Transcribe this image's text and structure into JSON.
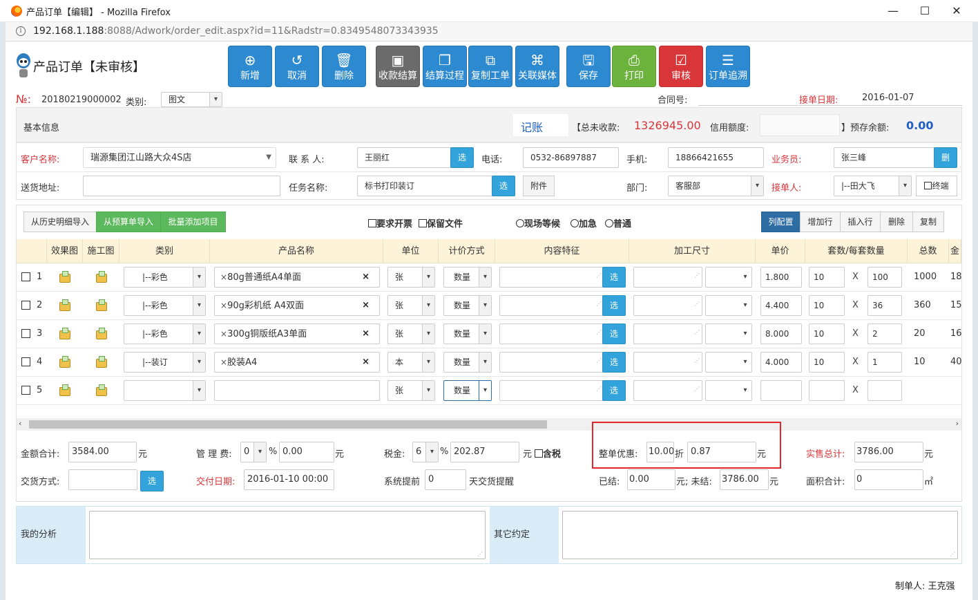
{
  "window": {
    "title": "产品订单【编辑】 - Mozilla Firefox",
    "min": "—",
    "max": "☐",
    "close": "✕"
  },
  "url": {
    "host": "192.168.1.188",
    "rest": ":8088/Adwork/order_edit.aspx?id=11&Radstr=0.8349548073343935"
  },
  "header": {
    "title": "产品订单【未审核】"
  },
  "toolbar": [
    {
      "label": "新增",
      "icon": "plus-circle-icon",
      "glyph": "⊕"
    },
    {
      "label": "取消",
      "icon": "undo-icon",
      "glyph": "↺"
    },
    {
      "label": "删除",
      "icon": "trash-icon",
      "glyph": "🗑"
    },
    {
      "label": "收款结算",
      "icon": "money-icon",
      "glyph": "▣"
    },
    {
      "label": "结算过程",
      "icon": "document-icon",
      "glyph": "❐"
    },
    {
      "label": "复制工单",
      "icon": "copy-icon",
      "glyph": "⧉"
    },
    {
      "label": "关联媒体",
      "icon": "paperclip-icon",
      "glyph": "⌘"
    },
    {
      "label": "保存",
      "icon": "save-icon",
      "glyph": "🖫"
    },
    {
      "label": "打印",
      "icon": "print-icon",
      "glyph": "⎙"
    },
    {
      "label": "审核",
      "icon": "check-icon",
      "glyph": "☑"
    },
    {
      "label": "订单追溯",
      "icon": "list-icon",
      "glyph": "☰"
    }
  ],
  "order": {
    "no_label": "№:",
    "no": "20180219000002",
    "type_label": "类别:",
    "type": "图文",
    "contract_label": "合同号:",
    "date_label": "接单日期:",
    "date": "2016-01-07"
  },
  "basic": {
    "title": "基本信息",
    "bookkeeping": "记账",
    "unpaid_label": "【总未收款:",
    "unpaid": "1326945.00",
    "credit_label": "信用额度:",
    "prepaid_label": "】预存余额:",
    "prepaid": "0.00",
    "customer_label": "客户名称:",
    "customer": "瑞源集团江山路大众4S店",
    "contact_label": "联 系 人:",
    "contact": "王丽红",
    "select_btn": "选",
    "phone_label": "电话:",
    "phone": "0532-86897887",
    "mobile_label": "手机:",
    "mobile": "18866421655",
    "salesman_label": "业务员:",
    "salesman": "张三峰",
    "delete_btn": "删",
    "address_label": "送货地址:",
    "address": "",
    "task_label": "任务名称:",
    "task": "标书打印装订",
    "attach_btn": "附件",
    "dept_label": "部门:",
    "dept": "客服部",
    "receiver_label": "接单人:",
    "receiver": "|--田大飞",
    "final_label": "终端"
  },
  "items_toolbar": {
    "import_history": "从历史明细导入",
    "import_budget": "从预算单导入",
    "batch_add": "批量添加项目",
    "invoice": "要求开票",
    "keep_file": "保留文件",
    "opt_wait": "现场等候",
    "opt_urgent": "加急",
    "opt_normal": "普通",
    "col_config": "列配置",
    "add_row": "增加行",
    "insert_row": "插入行",
    "delete": "删除",
    "copy": "复制"
  },
  "columns": [
    "效果图",
    "施工图",
    "类别",
    "产品名称",
    "单位",
    "计价方式",
    "内容特征",
    "加工尺寸",
    "单价",
    "套数/每套数量",
    "总数",
    "金"
  ],
  "rows": [
    {
      "no": "1",
      "category": "|--彩色",
      "product": "80g普通纸A4单面",
      "unit": "张",
      "pricing": "数量",
      "price": "1.800",
      "sets": "10",
      "per": "100",
      "total": "1000",
      "amt": "18"
    },
    {
      "no": "2",
      "category": "|--彩色",
      "product": "90g彩机纸 A4双面",
      "unit": "张",
      "pricing": "数量",
      "price": "4.400",
      "sets": "10",
      "per": "36",
      "total": "360",
      "amt": "15"
    },
    {
      "no": "3",
      "category": "|--彩色",
      "product": "300g铜版纸A3单面",
      "unit": "张",
      "pricing": "数量",
      "price": "8.000",
      "sets": "10",
      "per": "2",
      "total": "20",
      "amt": "16"
    },
    {
      "no": "4",
      "category": "|--装订",
      "product": "胶装A4",
      "unit": "本",
      "pricing": "数量",
      "price": "4.000",
      "sets": "10",
      "per": "1",
      "total": "10",
      "amt": "40"
    },
    {
      "no": "5",
      "category": "",
      "product": "",
      "unit": "张",
      "pricing": "数量",
      "price": "",
      "sets": "",
      "per": "",
      "total": "",
      "amt": ""
    }
  ],
  "x_mark": "X",
  "tag_remove": "×",
  "totals": {
    "amount_label": "金额合计:",
    "amount": "3584.00",
    "yuan": "元",
    "mgmt_label": "管 理 费:",
    "mgmt_pct": "0",
    "pct": "%",
    "mgmt_amt": "0.00",
    "tax_label": "税金:",
    "tax_pct": "6",
    "tax_amt": "202.87",
    "tax_incl": "含税",
    "discount_label": "整单优惠:",
    "discount_rate": "10.00",
    "discount_unit": "折",
    "discount_amt": "0.87",
    "sale_total_label": "实售总计:",
    "sale_total": "3786.00",
    "pay_label": "交货方式:",
    "pay_btn": "选",
    "deliver_label": "交付日期:",
    "deliver": "2016-01-10 00:00",
    "remind_label": "系统提前",
    "remind_days": "0",
    "remind_suffix": "天交货提醒",
    "settled_label": "已结:",
    "settled": "0.00",
    "unsettled_label": "元; 未结:",
    "unsettled": "3786.00",
    "area_label": "面积合计:",
    "area": "0",
    "area_unit": "㎡"
  },
  "analysis": {
    "mine": "我的分析",
    "other": "其它约定"
  },
  "footer": {
    "maker": "制单人: 王克强"
  }
}
